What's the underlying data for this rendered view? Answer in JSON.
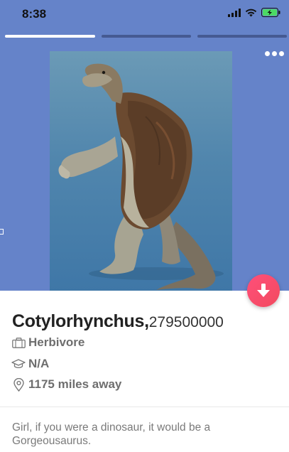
{
  "status_bar": {
    "time": "8:38",
    "icons": [
      "signal-icon",
      "wifi-icon",
      "battery-charging-icon"
    ],
    "battery_color": "#4cd964"
  },
  "photo": {
    "background_color": "#6583c9",
    "subject": "cotylorhynchus-illustration",
    "progress_segments": [
      {
        "active": true
      },
      {
        "active": false
      },
      {
        "active": false
      }
    ]
  },
  "actions": {
    "more_icon": "more-horizontal-icon",
    "expand_icon": "arrow-down-icon",
    "expand_color": "#f24a5f"
  },
  "profile": {
    "name": "Cotylorhynchus,",
    "age": "279500000",
    "job": "Herbivore",
    "school": "N/A",
    "distance": "1175 miles away"
  },
  "bio": "Girl, if you were a dinosaur, it would be a Gorgeousaurus."
}
